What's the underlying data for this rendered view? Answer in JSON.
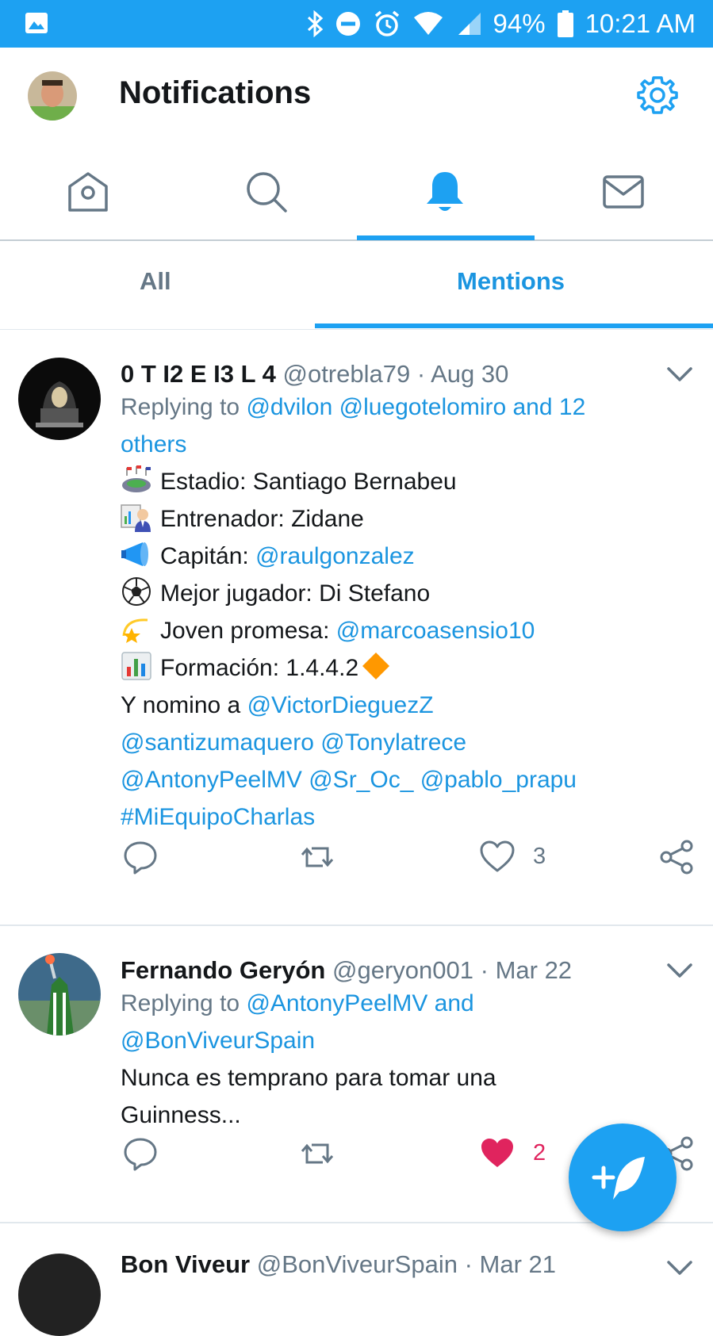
{
  "status_bar": {
    "battery": "94%",
    "time": "10:21 AM"
  },
  "header": {
    "title": "Notifications"
  },
  "sub_tabs": {
    "all": "All",
    "mentions": "Mentions"
  },
  "tweets": [
    {
      "name": "0 T I2 E I3 L 4",
      "handle": "@otrebla79",
      "sep": "·",
      "date": "Aug 30",
      "replying_prefix": "Replying to ",
      "replying_line1": "@dvilon @luegotelomiro and 12",
      "replying_line2": "others",
      "lines": [
        {
          "text": "Estadio: Santiago Bernabeu",
          "emoji": "stadium-emoji"
        },
        {
          "text": "Entrenador: Zidane",
          "emoji": "teacher-emoji"
        },
        {
          "text": "Capitán: ",
          "mention": "@raulgonzalez",
          "emoji": "megaphone-emoji"
        },
        {
          "text": "Mejor jugador: Di Stefano",
          "emoji": "soccer-ball-emoji"
        },
        {
          "text": "Joven promesa: ",
          "mention": "@marcoasensio10",
          "emoji": "dizzy-star-emoji"
        },
        {
          "text": "Formación: 1.4.4.2",
          "emoji": "bar-chart-emoji"
        }
      ],
      "nominate_prefix": "Y nomino a ",
      "nominate_line1": "@VictorDieguezZ",
      "nominate_line2": "@santizumaquero @Tonylatrece",
      "nominate_line3": "@AntonyPeelMV @Sr_Oc_ @pablo_prapu",
      "hashtag": "#MiEquipoCharlas",
      "likes": "3"
    },
    {
      "name": "Fernando Geryón",
      "handle": "@geryon001",
      "sep": "·",
      "date": "Mar 22",
      "replying_prefix": "Replying to ",
      "replying_line1": "@AntonyPeelMV and",
      "replying_line2": "@BonViveurSpain",
      "text_line1": "Nunca es temprano para tomar una",
      "text_line2": "Guinness...",
      "likes": "2"
    },
    {
      "name": "Bon Viveur",
      "handle": "@BonViveurSpain",
      "sep": "·",
      "date": "Mar 21"
    }
  ],
  "colors": {
    "accent": "#1da1f2",
    "mention": "#1b95e0",
    "muted": "#657786",
    "like_red": "#e0245e"
  }
}
